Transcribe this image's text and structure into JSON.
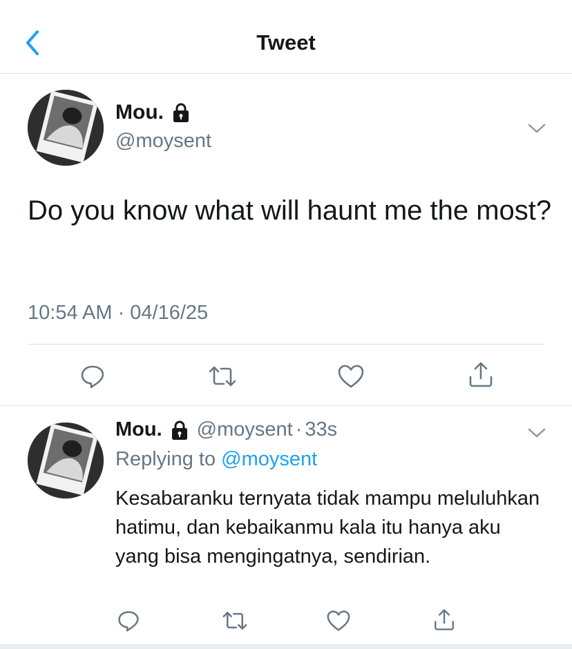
{
  "nav": {
    "title": "Tweet"
  },
  "tweet": {
    "name": "Mou.",
    "handle": "@moysent",
    "text": "Do you know what will haunt me the most?",
    "timestamp": "10:54 AM · 04/16/25"
  },
  "reply": {
    "name": "Mou.",
    "handle": "@moysent",
    "separator": "·",
    "time": "33s",
    "replying_prefix": "Replying to",
    "replying_handle": "@moysent",
    "text": "Kesabaranku ternyata tidak mampu meluluhkan hatimu, dan kebaikanmu kala itu hanya aku yang bisa mengingatnya, sendirian."
  },
  "colors": {
    "accent": "#1da1f2",
    "secondary_text": "#657786",
    "divider": "#dfe3e6",
    "icon": "#657786"
  },
  "icons": {
    "back": "chevron-left-icon",
    "lock": "lock-icon",
    "menu": "chevron-down-icon",
    "reply": "reply-icon",
    "retweet": "retweet-icon",
    "like": "heart-icon",
    "share": "share-icon"
  }
}
